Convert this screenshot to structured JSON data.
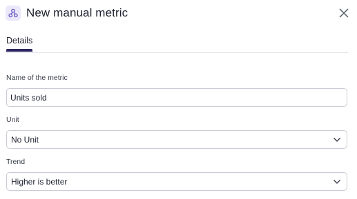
{
  "dialog": {
    "title": "New manual metric",
    "title_icon": "metric-nodes-icon",
    "close_icon": "close-icon"
  },
  "tabs": [
    {
      "label": "Details",
      "active": true
    }
  ],
  "form": {
    "name_label": "Name of the metric",
    "name_value": "Units sold",
    "unit_label": "Unit",
    "unit_value": "No Unit",
    "trend_label": "Trend",
    "trend_value": "Higher is better"
  },
  "colors": {
    "accent": "#2b2461",
    "icon_bg": "#ece8fb",
    "border": "#c9cbd3"
  }
}
